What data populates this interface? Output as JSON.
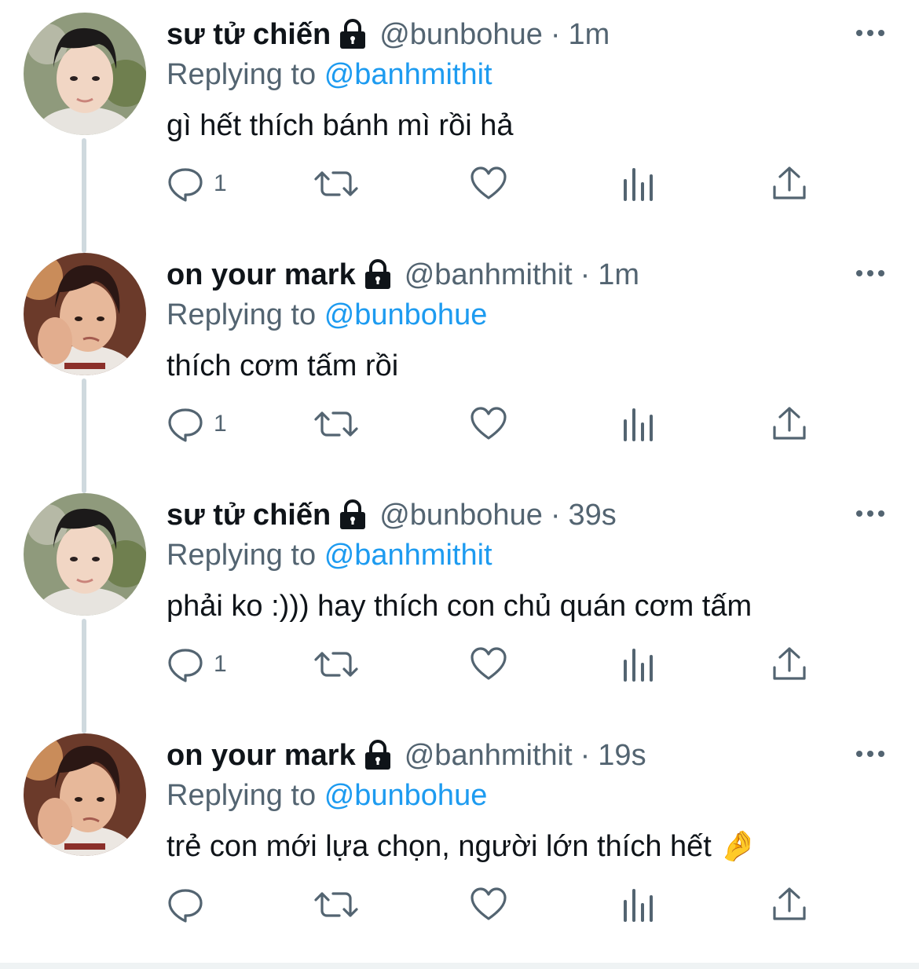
{
  "colors": {
    "link": "#1d9bf0",
    "secondary": "#536471",
    "primary": "#0f1419",
    "thread_line": "#cfd9de"
  },
  "tweets": [
    {
      "avatar": "avatar-su-tu-chien",
      "name": "sư tử chiến",
      "handle": "@bunbohue",
      "dot": "·",
      "time": "1m",
      "replying_prefix": "Replying to",
      "replying_to": "@banhmithit",
      "text": "gì hết thích bánh mì rồi hả",
      "reply_count": "1"
    },
    {
      "avatar": "avatar-on-your-mark",
      "name": "on your mark",
      "handle": "@banhmithit",
      "dot": "·",
      "time": "1m",
      "replying_prefix": "Replying to",
      "replying_to": "@bunbohue",
      "text": "thích cơm tấm rồi",
      "reply_count": "1"
    },
    {
      "avatar": "avatar-su-tu-chien",
      "name": "sư tử chiến",
      "handle": "@bunbohue",
      "dot": "·",
      "time": "39s",
      "replying_prefix": "Replying to",
      "replying_to": "@banhmithit",
      "text": "phải ko :))) hay thích con chủ quán cơm tấm",
      "reply_count": "1"
    },
    {
      "avatar": "avatar-on-your-mark",
      "name": "on your mark",
      "handle": "@banhmithit",
      "dot": "·",
      "time": "19s",
      "replying_prefix": "Replying to",
      "replying_to": "@bunbohue",
      "text": "trẻ con mới lựa chọn, người lớn thích hết 🤌",
      "reply_count": ""
    }
  ],
  "icons": {
    "reply": "reply-icon",
    "retweet": "retweet-icon",
    "like": "heart-icon",
    "views": "analytics-icon",
    "share": "share-icon",
    "more": "more-icon",
    "lock": "lock-icon"
  }
}
